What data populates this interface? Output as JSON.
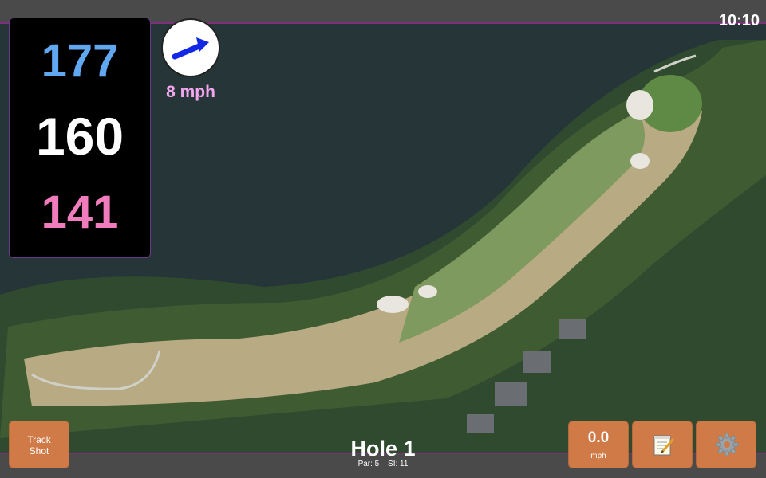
{
  "status_bar": {
    "time": "10:10"
  },
  "distances": {
    "back": "177",
    "middle": "160",
    "front": "141"
  },
  "wind": {
    "speed": "8 mph",
    "direction_icon": "arrow-right-icon"
  },
  "hole": {
    "title": "Hole 1",
    "par": "Par: 5",
    "stroke_index": "SI: 11"
  },
  "buttons": {
    "track_shot": "Track\nShot",
    "speed_value": "0.0",
    "speed_unit": "mph",
    "notes_icon": "notepad-icon",
    "settings_icon": "gear-icon"
  },
  "colors": {
    "accent_button": "#d07a47",
    "back_distance": "#62a8f0",
    "middle_distance": "#ffffff",
    "front_distance": "#f07bbd",
    "wind_speed_text": "#f2a6ee"
  }
}
